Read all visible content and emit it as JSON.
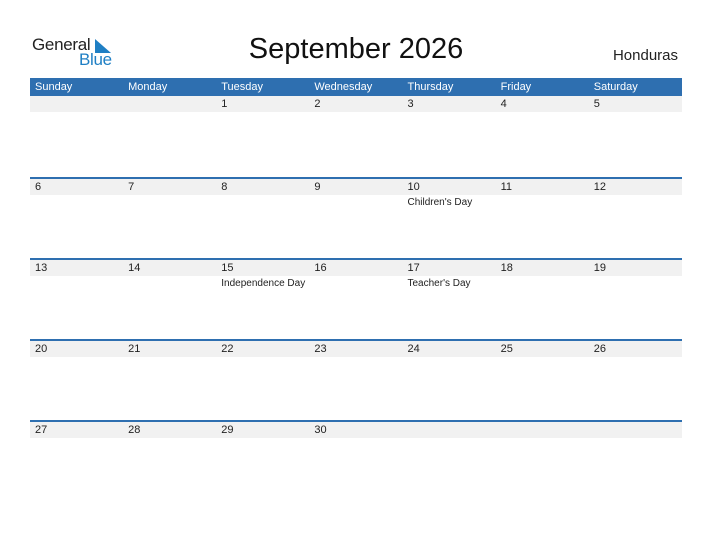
{
  "logo": {
    "part1": "General",
    "part2": "Blue"
  },
  "title": "September 2026",
  "country": "Honduras",
  "colors": {
    "header": "#2e6fb0",
    "band": "#f1f1f1",
    "logo_blue": "#1f7fc4"
  },
  "weekdays": [
    "Sunday",
    "Monday",
    "Tuesday",
    "Wednesday",
    "Thursday",
    "Friday",
    "Saturday"
  ],
  "weeks": [
    [
      {
        "d": ""
      },
      {
        "d": ""
      },
      {
        "d": "1"
      },
      {
        "d": "2"
      },
      {
        "d": "3"
      },
      {
        "d": "4"
      },
      {
        "d": "5"
      }
    ],
    [
      {
        "d": "6"
      },
      {
        "d": "7"
      },
      {
        "d": "8"
      },
      {
        "d": "9"
      },
      {
        "d": "10",
        "e": "Children's Day"
      },
      {
        "d": "11"
      },
      {
        "d": "12"
      }
    ],
    [
      {
        "d": "13"
      },
      {
        "d": "14"
      },
      {
        "d": "15",
        "e": "Independence Day"
      },
      {
        "d": "16"
      },
      {
        "d": "17",
        "e": "Teacher's Day"
      },
      {
        "d": "18"
      },
      {
        "d": "19"
      }
    ],
    [
      {
        "d": "20"
      },
      {
        "d": "21"
      },
      {
        "d": "22"
      },
      {
        "d": "23"
      },
      {
        "d": "24"
      },
      {
        "d": "25"
      },
      {
        "d": "26"
      }
    ],
    [
      {
        "d": "27"
      },
      {
        "d": "28"
      },
      {
        "d": "29"
      },
      {
        "d": "30"
      },
      {
        "d": ""
      },
      {
        "d": ""
      },
      {
        "d": ""
      }
    ]
  ]
}
